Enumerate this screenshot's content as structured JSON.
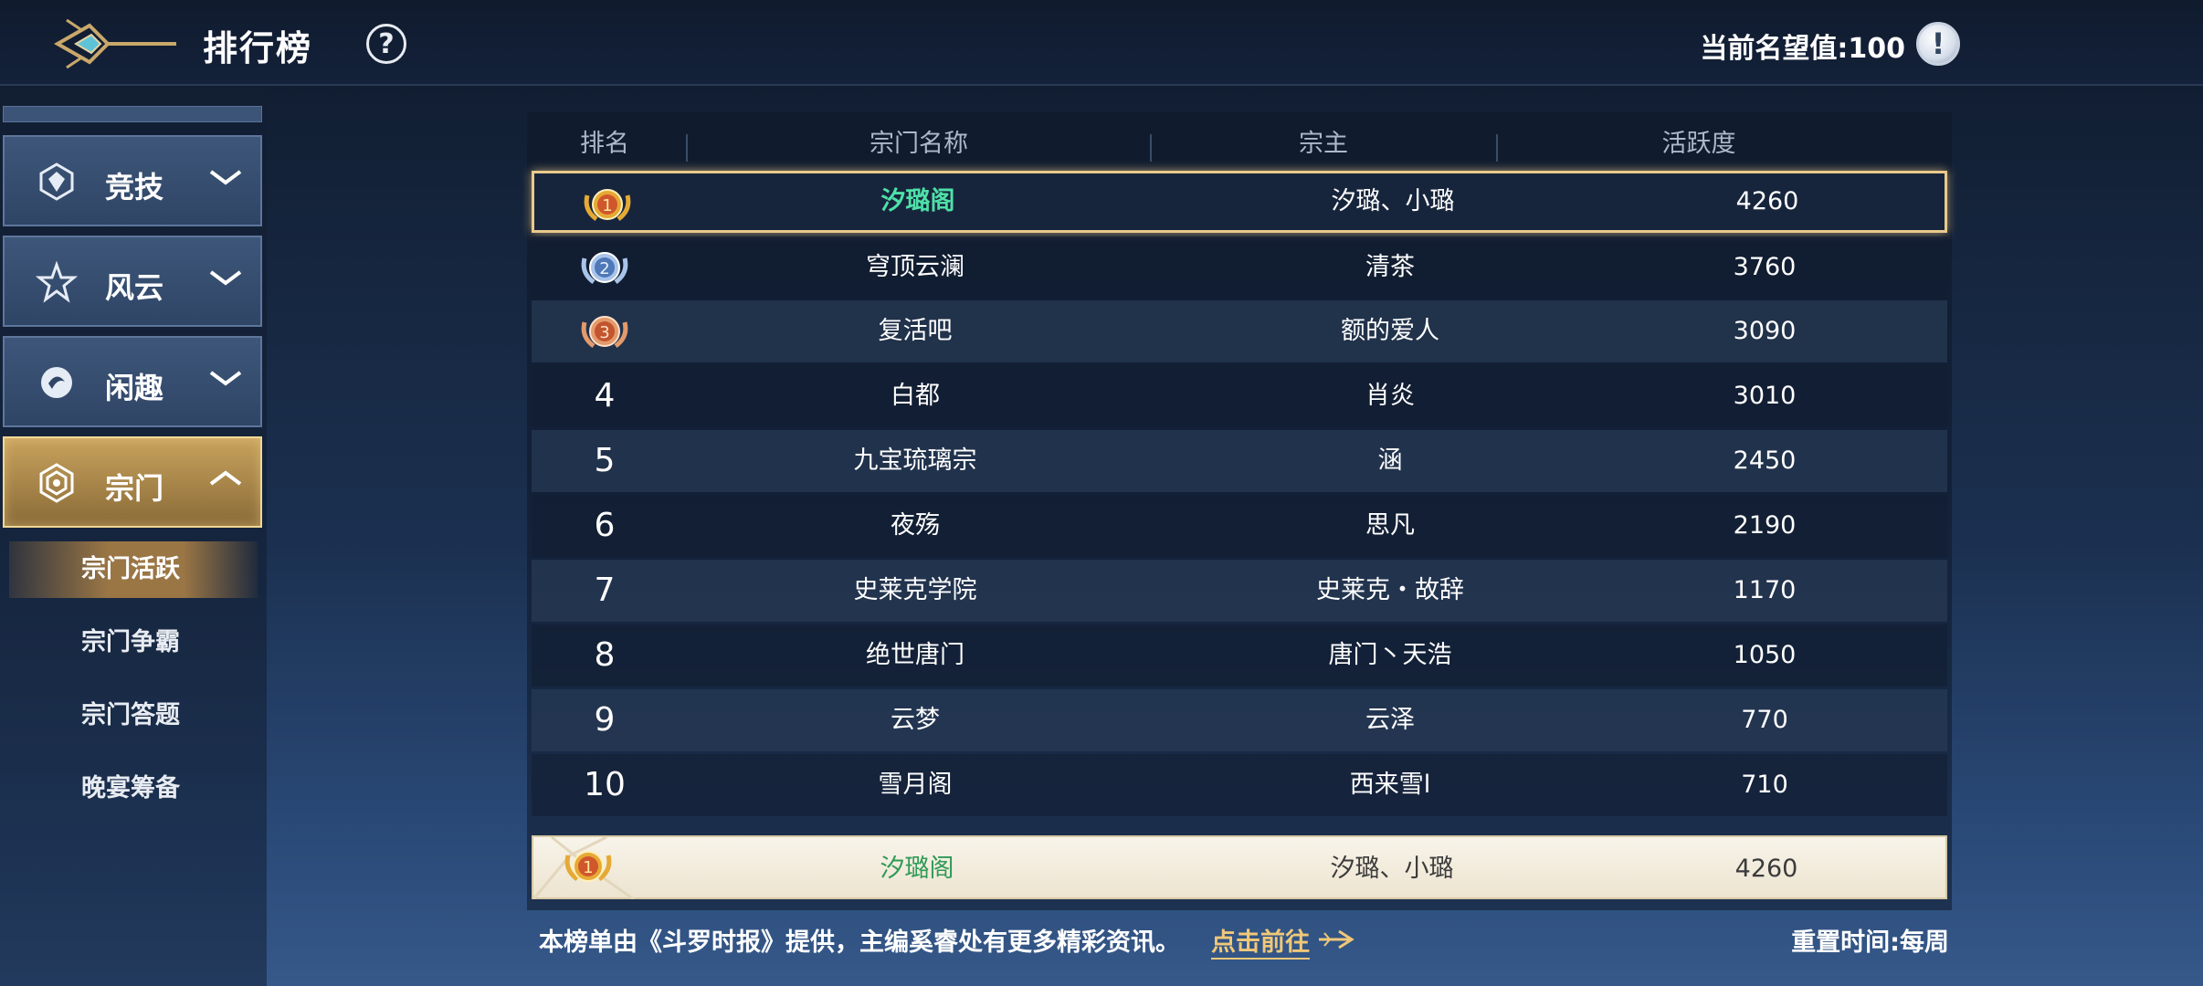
{
  "header": {
    "title": "排行榜",
    "help_symbol": "?",
    "prestige_text": "当前名望值:100",
    "info_symbol": "!"
  },
  "sidebar": {
    "categories": [
      {
        "label": "竞技",
        "icon": "arena-icon",
        "expanded": false
      },
      {
        "label": "风云",
        "icon": "star-badge-icon",
        "expanded": false
      },
      {
        "label": "闲趣",
        "icon": "leisure-icon",
        "expanded": false
      },
      {
        "label": "宗门",
        "icon": "sect-icon",
        "expanded": true
      }
    ],
    "subitems": [
      {
        "label": "宗门活跃",
        "active": true
      },
      {
        "label": "宗门争霸",
        "active": false
      },
      {
        "label": "宗门答题",
        "active": false
      },
      {
        "label": "晚宴筹备",
        "active": false
      }
    ]
  },
  "table": {
    "headers": [
      "排名",
      "宗门名称",
      "宗主",
      "活跃度"
    ],
    "rows": [
      {
        "rank": "1",
        "name": "汐璐阁",
        "leader": "汐璐、小璐",
        "activity": "4260"
      },
      {
        "rank": "2",
        "name": "穹顶云澜",
        "leader": "清茶",
        "activity": "3760"
      },
      {
        "rank": "3",
        "name": "复活吧",
        "leader": "额的爱人",
        "activity": "3090"
      },
      {
        "rank": "4",
        "name": "白都",
        "leader": "肖炎",
        "activity": "3010"
      },
      {
        "rank": "5",
        "name": "九宝琉璃宗",
        "leader": "涵",
        "activity": "2450"
      },
      {
        "rank": "6",
        "name": "夜殇",
        "leader": "思凡",
        "activity": "2190"
      },
      {
        "rank": "7",
        "name": "史莱克学院",
        "leader": "史莱克・故辞",
        "activity": "1170"
      },
      {
        "rank": "8",
        "name": "绝世唐门",
        "leader": "唐门丶天浩",
        "activity": "1050"
      },
      {
        "rank": "9",
        "name": "云梦",
        "leader": "云泽",
        "activity": "770"
      },
      {
        "rank": "10",
        "name": "雪月阁",
        "leader": "西来雪l",
        "activity": "710"
      }
    ],
    "self_row": {
      "rank": "1",
      "name": "汐璐阁",
      "leader": "汐璐、小璐",
      "activity": "4260"
    }
  },
  "footer": {
    "note": "本榜单由《斗罗时报》提供，主编奚睿处有更多精彩资讯。",
    "link": "点击前往",
    "reset": "重置时间:每周"
  },
  "colors": {
    "gold": "#e9c98b",
    "top_name_green": "#4ee0a8",
    "self_name_green": "#2f9a56",
    "medal_gold": "#e6a935",
    "medal_silver": "#7fa4d8",
    "medal_bronze": "#d9774b"
  }
}
